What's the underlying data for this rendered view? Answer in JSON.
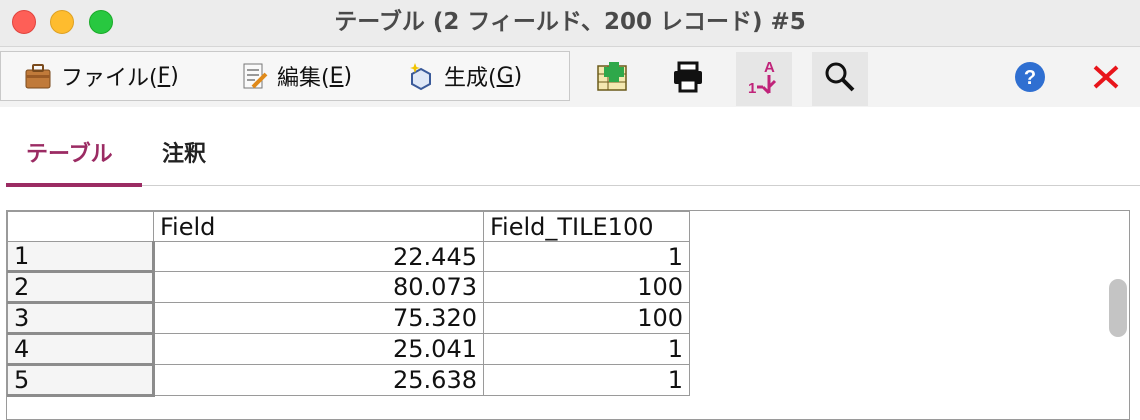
{
  "window": {
    "title": "テーブル (2 フィールド、200 レコード) #5"
  },
  "menubar": {
    "file": {
      "label": "ファイル(",
      "key": "F",
      "tail": ")",
      "icon": "briefcase-icon"
    },
    "edit": {
      "label": "編集(",
      "key": "E",
      "tail": ")",
      "icon": "edit-document-icon"
    },
    "generate": {
      "label": "生成(",
      "key": "G",
      "tail": ")",
      "icon": "sparkle-generate-icon"
    }
  },
  "toolbar": {
    "icons": [
      "add-table-icon",
      "print-icon",
      "sort-icon",
      "search-icon",
      "help-icon",
      "close-icon"
    ],
    "sort_glyph_a": "A",
    "sort_glyph_1": "1"
  },
  "tabs": [
    {
      "label": "テーブル",
      "active": true
    },
    {
      "label": "注釈",
      "active": false
    }
  ],
  "table": {
    "columns": [
      "",
      "Field",
      "Field_TILE100"
    ],
    "rows": [
      {
        "index": "1",
        "field": "22.445",
        "tile": "1"
      },
      {
        "index": "2",
        "field": "80.073",
        "tile": "100"
      },
      {
        "index": "3",
        "field": "75.320",
        "tile": "100"
      },
      {
        "index": "4",
        "field": "25.041",
        "tile": "1"
      },
      {
        "index": "5",
        "field": "25.638",
        "tile": "1"
      }
    ]
  },
  "colors": {
    "accent": "#9b2b63",
    "close_red": "#e8141a",
    "help_blue": "#2f6fd1"
  }
}
